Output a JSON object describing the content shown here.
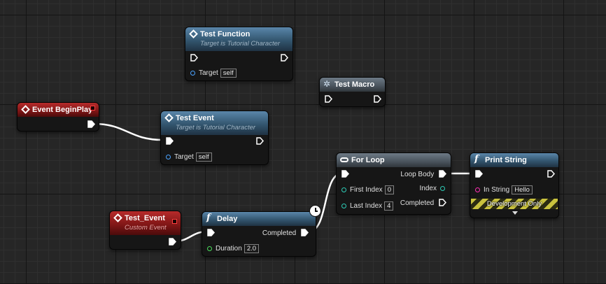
{
  "nodes": {
    "test_function": {
      "title": "Test Function",
      "subtitle": "Target is Tutorial Character",
      "target_label": "Target",
      "target_value": "self"
    },
    "test_macro": {
      "title": "Test Macro"
    },
    "event_begin_play": {
      "title": "Event BeginPlay"
    },
    "test_event": {
      "title": "Test Event",
      "subtitle": "Target is Tutorial Character",
      "target_label": "Target",
      "target_value": "self"
    },
    "custom_event": {
      "title": "Test_Event",
      "subtitle": "Custom Event"
    },
    "delay": {
      "title": "Delay",
      "completed_label": "Completed",
      "duration_label": "Duration",
      "duration_value": "2.0"
    },
    "for_loop": {
      "title": "For Loop",
      "loop_body_label": "Loop Body",
      "first_index_label": "First Index",
      "first_index_value": "0",
      "index_label": "Index",
      "last_index_label": "Last Index",
      "last_index_value": "4",
      "completed_label": "Completed"
    },
    "print_string": {
      "title": "Print String",
      "in_string_label": "In String",
      "in_string_value": "Hello",
      "dev_label": "Development Only"
    }
  },
  "colors": {
    "exec_wire": "#ffffff",
    "function_header": "#33566f",
    "event_header": "#7d1515",
    "macro_header": "#4a545d",
    "object_pin": "#4aa3ff",
    "float_pin": "#4bdc5c",
    "int_pin": "#2ecdb7",
    "string_pin": "#ff2fb4"
  }
}
